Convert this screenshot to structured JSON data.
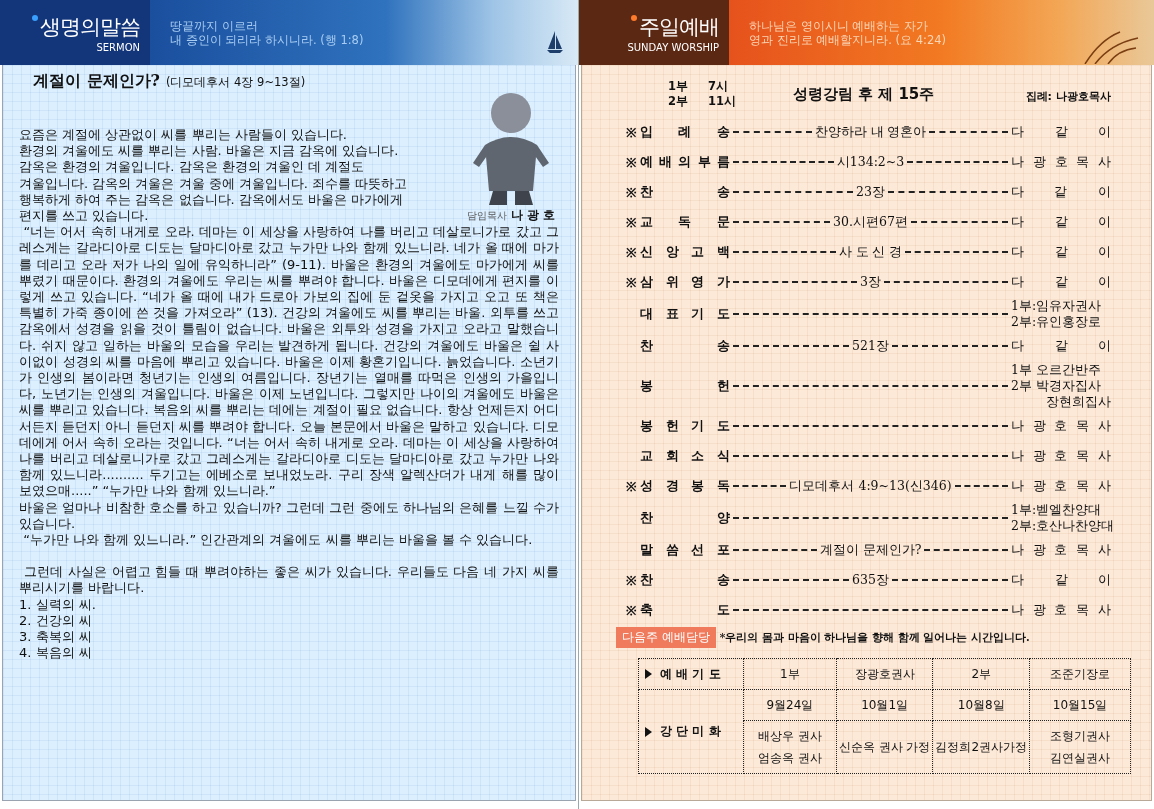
{
  "sermon_header": {
    "title": "생명의말씀",
    "subtitle": "SERMON",
    "verse_lines": [
      "땅끝까지 이르러",
      "내 증인이 되리라 하시니라. (행 1:8)"
    ]
  },
  "sermon": {
    "title": "계절이 문제인가?",
    "reference": "(디모데후서 4장 9~13절)",
    "pastor_role": "담임목사",
    "pastor_name": "나 광 호",
    "intro_lines": [
      "요즘은 계절에 상관없이 씨를 뿌리는 사람들이 있습니다.",
      "환경의 겨울에도 씨를 뿌리는 사람. 바울은 지금 감옥에 있습니다.",
      "감옥은 환경의 겨울입니다. 감옥은 환경의 겨울인 데 계절도",
      "겨울입니다. 감옥의 겨울은 겨울 중에 겨울입니다. 죄수를 따뜻하고",
      "행복하게 하여 주는 감옥은 없습니다. 감옥에서도 바울은 마가에게",
      "편지를 쓰고 있습니다."
    ],
    "paragraphs": [
      " “너는 어서 속히 내게로 오라. 데마는 이 세상을 사랑하여 나를 버리고 데살로니가로 갔고 그레스게는 갈라디아로 디도는 달마디아로 갔고 누가만 나와 함께 있느니라. 네가 올 때에 마가를 데리고 오라 저가 나의 일에 유익하니라” (9-11). 바울은 환경의 겨울에도 마가에게 씨를 뿌렸기 때문이다. 환경의 겨울에도 우리는 씨를 뿌려야 합니다. 바울은 디모데에게 편지를 이렇게 쓰고 있습니다. “네가 올 때에 내가 드로아 가보의 집에 둔 겉옷을 가지고 오고 또 책은 특별히 가죽 종이에 쓴 것을 가져오라” (13). 건강의 겨울에도 씨를 뿌리는 바울. 외투를 쓰고 감옥에서 성경을 읽을 것이 틀림이 없습니다. 바울은 외투와 성경을 가지고 오라고 말했습니다. 쉬지 않고 일하는 바울의 모습을 우리는 발견하게 됩니다. 건강의 겨울에도 바울은 쉴 사이없이 성경의 씨를 마음에 뿌리고 있습니다. 바울은 이제 황혼기입니다. 늙었습니다. 소년기가 인생의 봄이라면 청년기는 인생의 여름입니다. 장년기는 열매를 따먹은 인생의 가을입니다, 노년기는 인생의 겨울입니다. 바울은 이제 노년입니다. 그렇지만 나이의 겨울에도 바울은 씨를 뿌리고 있습니다. 복음의 씨를 뿌리는 데에는 계절이 필요 없습니다. 항상 언제든지 어디서든지 듣던지 아니 듣던지 씨를 뿌려야 합니다. 오늘 본문에서 바울은 말하고 있습니다. 디모데에게 어서 속히 오라는 것입니다. “너는 어서 속히 내게로 오라. 데마는 이 세상을 사랑하여 나를 버리고 데살로니가로 갔고 그레스게는 갈라디아로 디도는 달마디아로 갔고 누가만 나와 함께 있느니라.......... 두기고는 에베소로 보내었노라. 구리 장색 알렉산더가 내게 해를 많이 보였으매.....” “누가만 나와 함께 있느니라.”",
      "바울은 얼마나 비참한 호소를 하고 있습니까? 그런데 그런 중에도 하나님의 은혜를 느낄 수가 있습니다.",
      " “누가만 나와 함께 있느니라.” 인간관계의 겨울에도 씨를 뿌리는 바울을 볼 수 있습니다."
    ],
    "closing": " 그런데 사실은 어렵고 힘들 때 뿌려야하는 좋은 씨가 있습니다. 우리들도 다음 네 가지 씨를 뿌리시기를 바랍니다.",
    "points": [
      "1. 실력의 씨.",
      "2. 건강의 씨",
      "3. 축복의 씨",
      "4. 복음의 씨"
    ]
  },
  "worship_header": {
    "title": "주일예배",
    "subtitle": "SUNDAY WORSHIP",
    "verse_lines": [
      "하나님은 영이시니 예배하는 자가",
      "영과 진리로 예배할지니라. (요 4:24)"
    ]
  },
  "service": {
    "times": [
      {
        "part": "1부",
        "time": "7시"
      },
      {
        "part": "2부",
        "time": "11시"
      }
    ],
    "title": "성령강림 후 제 15주",
    "presider_label": "집례:",
    "presider": "나광호목사"
  },
  "order": [
    {
      "mark": "※",
      "label": "입 례 송",
      "content": "찬양하라 내 영혼아",
      "leader": [
        "다 같 이"
      ]
    },
    {
      "mark": "※",
      "label": "예 배 의 부 름",
      "content": "시134:2~3",
      "leader": [
        "나 광 호 목 사"
      ]
    },
    {
      "mark": "※",
      "label": "찬 송",
      "content": "23장",
      "leader": [
        "다 같 이"
      ]
    },
    {
      "mark": "※",
      "label": "교 독 문",
      "content": "30.시편67편",
      "leader": [
        "다 같 이"
      ]
    },
    {
      "mark": "※",
      "label": "신 앙 고 백",
      "content": "사 도 신 경",
      "leader": [
        "다 같 이"
      ]
    },
    {
      "mark": "※",
      "label": "삼 위 영 가",
      "content": "3장",
      "leader": [
        "다 같 이"
      ]
    },
    {
      "label": "대 표 기 도",
      "leader": [
        "1부:임유자권사",
        "2부:유인홍장로"
      ]
    },
    {
      "label": "찬 송",
      "content": "521장",
      "leader": [
        "다 같 이"
      ]
    },
    {
      "label": "봉 헌",
      "leader": [
        "1부 오르간반주",
        "2부 박경자집사",
        "장현희집사"
      ]
    },
    {
      "label": "봉 헌 기 도",
      "leader": [
        "나 광 호 목 사"
      ]
    },
    {
      "label": "교 회 소 식",
      "leader": [
        "나 광 호 목 사"
      ]
    },
    {
      "mark": "※",
      "label": "성 경 봉 독",
      "content": "디모데후서 4:9~13(신346)",
      "leader": [
        "나 광 호 목 사"
      ]
    },
    {
      "label": "찬 양",
      "leader": [
        "1부:벧엘찬양대",
        "2부:호산나찬양대"
      ]
    },
    {
      "label": "말 씀 선 포",
      "content": "계절이 문제인가?",
      "leader": [
        "나 광 호 목 사"
      ]
    },
    {
      "mark": "※",
      "label": "찬 송",
      "content": "635장",
      "leader": [
        "다 같 이"
      ]
    },
    {
      "mark": "※",
      "label": "축 도",
      "leader": [
        "나 광 호 목 사"
      ]
    }
  ],
  "duty": {
    "tag": "다음주 예배담당",
    "note": "*우리의 몸과 마음이 하나님을 향해 함께 일어나는 시간입니다.",
    "prayer": {
      "label": "예 배 기 도",
      "cells": [
        "1부",
        "장광호권사",
        "2부",
        "조준기장로"
      ]
    },
    "flowers": {
      "label": "강 단 미 화",
      "dates": [
        "9월24일",
        "10월1일",
        "10월8일",
        "10월15일"
      ],
      "names": [
        [
          "배상우 권사",
          "엄송옥 권사"
        ],
        [
          "신순옥 권사 가정"
        ],
        [
          "김정희2권사가정"
        ],
        [
          "조형기권사",
          "김연실권사"
        ]
      ]
    }
  }
}
